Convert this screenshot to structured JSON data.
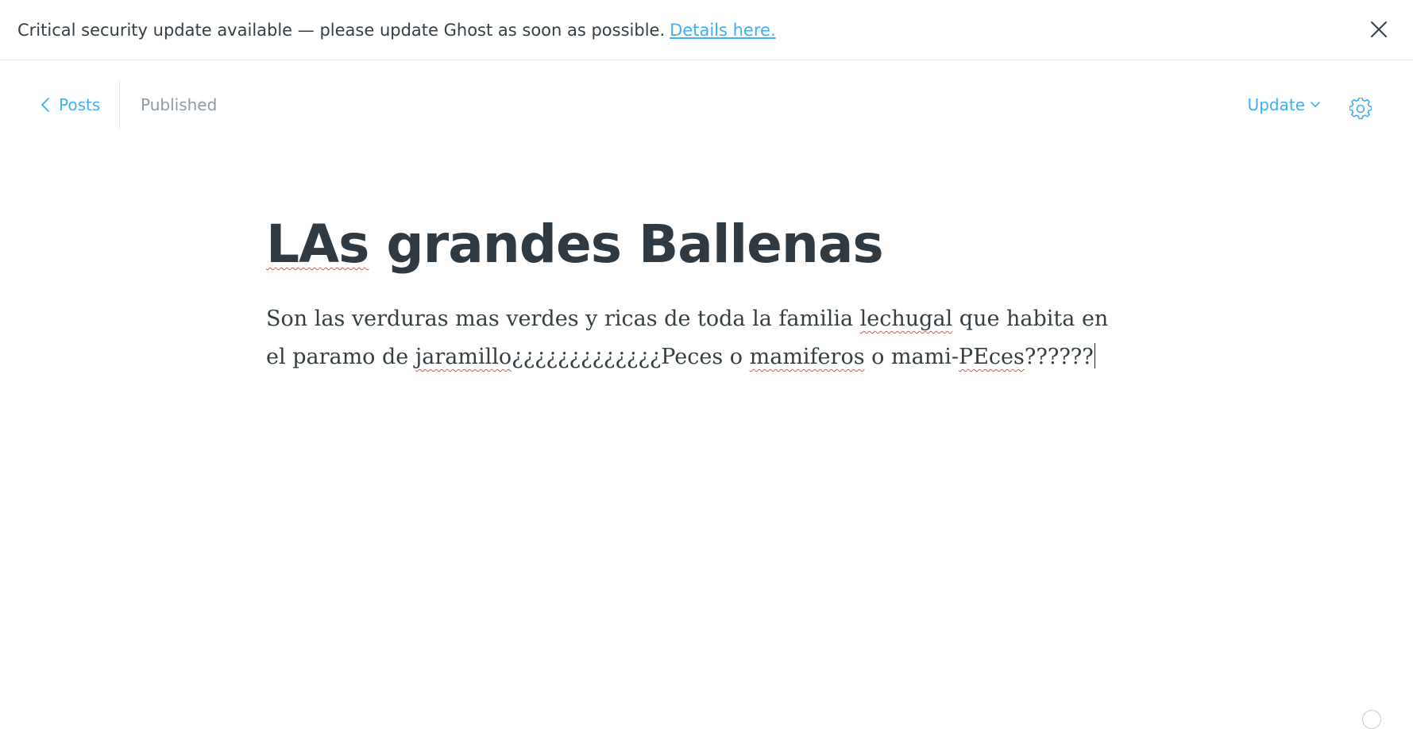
{
  "alert": {
    "message": "Critical security update available — please update Ghost as soon as possible.",
    "link_text": "Details here."
  },
  "header": {
    "back_label": "Posts",
    "status": "Published",
    "update_label": "Update"
  },
  "post": {
    "title_parts": [
      "LAs",
      " grandes Ballenas"
    ],
    "body_segments": [
      "Son las verduras mas verdes y ricas de toda la familia ",
      "lechugal",
      " que habita en el paramo de ",
      "jaramillo",
      "¿¿¿¿¿¿¿¿¿¿¿¿¿Peces o ",
      "mamiferos",
      " o mami-",
      "PEces",
      "??????"
    ]
  },
  "colors": {
    "accent": "#3eb0ef",
    "text": "#2f3a42",
    "muted": "#8e9ba3",
    "spellcheck": "#e25440"
  }
}
